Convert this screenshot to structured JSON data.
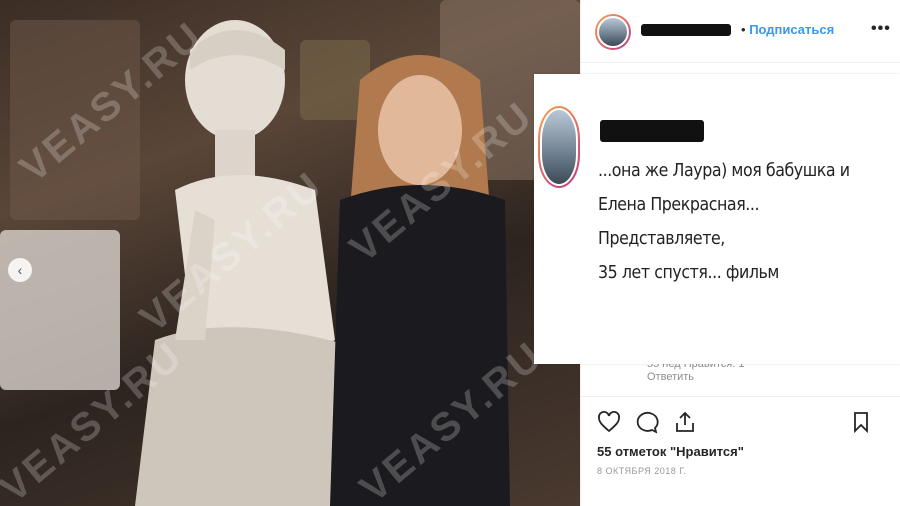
{
  "post": {
    "subscribe_label": "Подписаться",
    "separator": "•",
    "more_label": "•••",
    "caption": "...она же Лаура) моя бабушка и Елена Прекрасная... Представляете, 35 лет спустя⁠... фильм",
    "caption_lines": [
      "...она же Лаура) моя бабушка и",
      "Елена Прекрасная... Представляете,",
      "35 лет спустя⁠... фильм"
    ],
    "comment_meta": "55 нед    Нравится: 1",
    "reply_label": "Ответить",
    "likes_text": "55 отметок \"Нравится\"",
    "date_text": "8 ОКТЯБРЯ 2018 Г."
  },
  "photo": {
    "watermark": "VEASY.RU",
    "nav_prev": "‹"
  },
  "icons": {
    "heart": "heart-icon",
    "comment": "comment-icon",
    "share": "share-icon",
    "save": "bookmark-icon"
  },
  "colors": {
    "link_blue": "#3897f0",
    "text_dark": "#262626",
    "muted": "#8e8e8e"
  }
}
